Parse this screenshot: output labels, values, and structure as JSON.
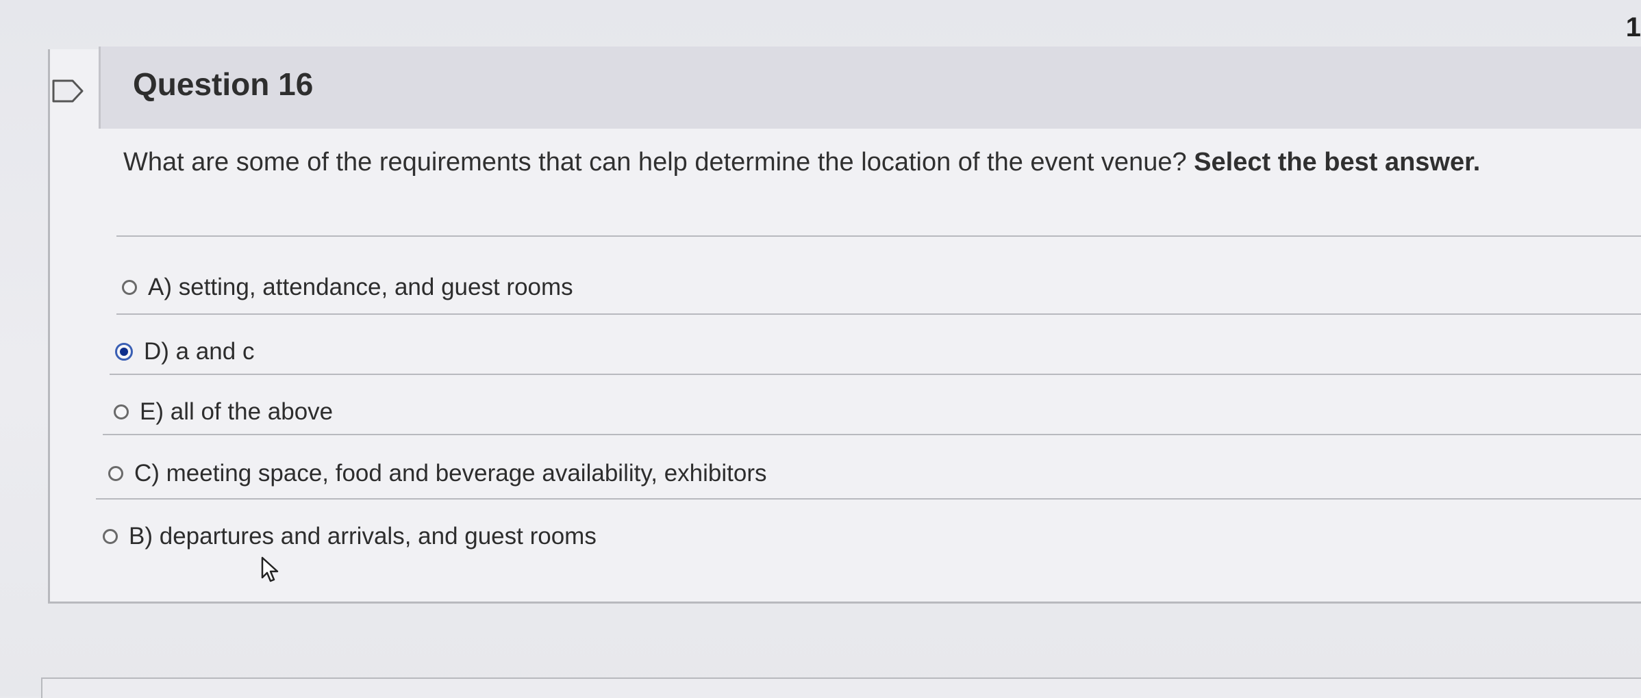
{
  "corner_number": "1",
  "question": {
    "title": "Question 16",
    "prompt": "What are some of the requirements that can help determine the location of the event venue? ",
    "instruction": "Select the best answer."
  },
  "answers": [
    {
      "label": "A) setting, attendance, and guest rooms",
      "selected": false
    },
    {
      "label": "D) a and c",
      "selected": true
    },
    {
      "label": "E) all of the above",
      "selected": false
    },
    {
      "label": "C) meeting space, food and beverage availability, exhibitors",
      "selected": false
    },
    {
      "label": "B) departures and arrivals, and guest rooms",
      "selected": false
    }
  ],
  "icons": {
    "flag": "flag-icon",
    "cursor": "mouse-pointer-icon"
  },
  "colors": {
    "selected_radio": "#0e2f8c",
    "header_bg": "#dcdce3"
  }
}
